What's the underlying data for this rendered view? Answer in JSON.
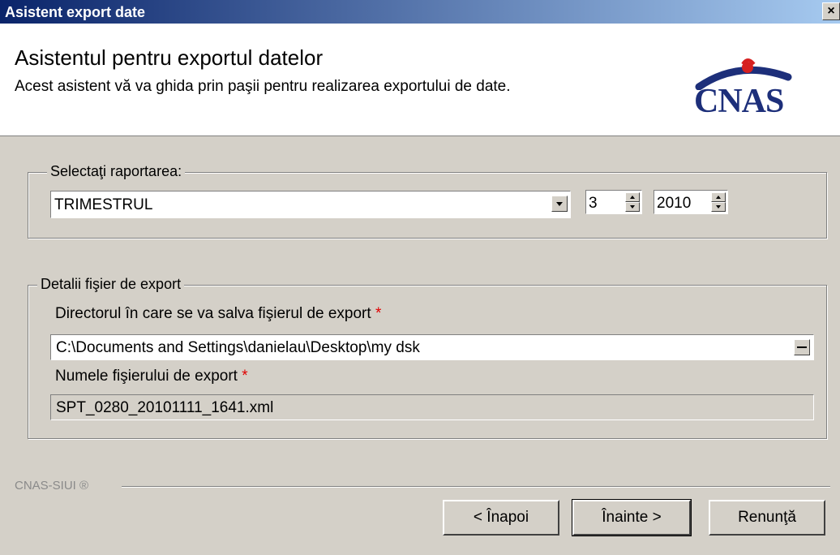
{
  "window": {
    "title": "Asistent export date",
    "close_glyph": "×"
  },
  "header": {
    "title": "Asistentul pentru exportul datelor",
    "subtitle": "Acest asistent vă va ghida prin paşii pentru realizarea exportului de date.",
    "logo_text": "CNAS",
    "logo_colors": {
      "primary": "#1d2f7a",
      "accent": "#d62020"
    }
  },
  "report_group": {
    "legend": "Selectaţi raportarea:",
    "period_type": "TRIMESTRUL",
    "period_number": "3",
    "year": "2010"
  },
  "export_group": {
    "legend": "Detalii fişier de export",
    "directory_label": "Directorul în care se va salva fişierul de export",
    "directory_value": "C:\\Documents and Settings\\danielau\\Desktop\\my dsk",
    "filename_label": "Numele fişierului de export",
    "filename_value": "SPT_0280_20101111_1641.xml",
    "required_mark": "*",
    "browse_glyph": "..."
  },
  "footer": {
    "brand": "CNAS-SIUI ®",
    "back_label": "< Înapoi",
    "next_label": "Înainte >",
    "cancel_label": "Renunţă"
  }
}
